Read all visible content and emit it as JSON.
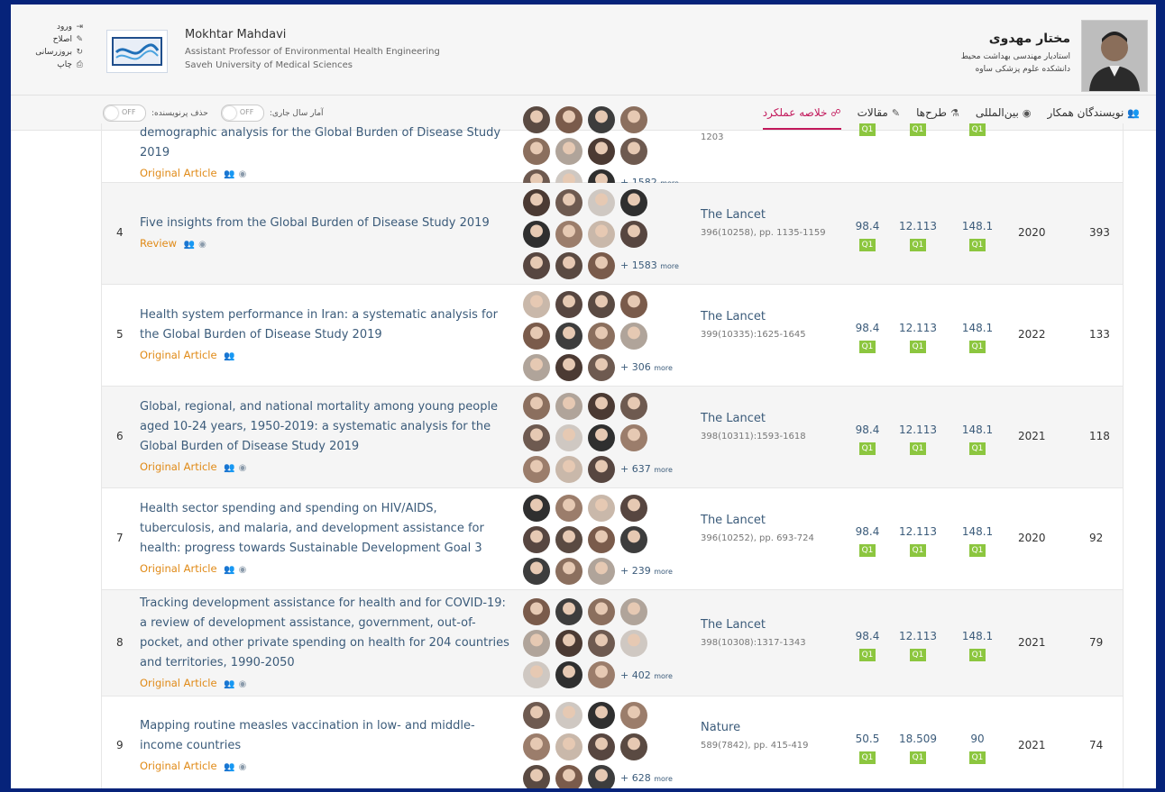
{
  "header": {
    "actions": [
      {
        "label": "ورود",
        "icon": "sign-in-icon",
        "glyph": "⇥"
      },
      {
        "label": "اصلاح",
        "icon": "pencil-icon",
        "glyph": "✎"
      },
      {
        "label": "بروزرسانی",
        "icon": "refresh-icon",
        "glyph": "↻"
      },
      {
        "label": "چاپ",
        "icon": "print-icon",
        "glyph": "⎙"
      }
    ],
    "en_name": "Mokhtar Mahdavi",
    "en_title": "Assistant Professor of Environmental Health Engineering",
    "en_affiliation": "Saveh University of Medical Sciences",
    "fa_name": "مختار مهدوی",
    "fa_title": "استادیار مهندسی بهداشت محیط",
    "fa_affiliation": "دانشکده علوم پزشکی ساوه"
  },
  "nav": {
    "tabs": [
      {
        "label": "خلاصه عملکرد",
        "icon": "summary-icon",
        "glyph": "☍",
        "active": true
      },
      {
        "label": "مقالات",
        "icon": "pencil-icon",
        "glyph": "✎",
        "active": false
      },
      {
        "label": "طرح‌ها",
        "icon": "flask-icon",
        "glyph": "⚗",
        "active": false
      },
      {
        "label": "بین‌المللی",
        "icon": "globe-icon",
        "glyph": "◉",
        "active": false
      },
      {
        "label": "نویسندگان همکار",
        "icon": "users-icon",
        "glyph": "👥",
        "active": false
      }
    ],
    "toggle_current_year": "آمار سال جاری:",
    "toggle_remove_prolific": "حذف پرنویسنده:",
    "toggle_state": "OFF"
  },
  "rows": [
    {
      "num": "",
      "title": "demographic analysis for the Global Burden of Disease Study 2019",
      "type": "Original Article",
      "intl": true,
      "more": "+ 1582",
      "journal": "",
      "ref": "1203",
      "m1": "",
      "m2": "",
      "m3": "",
      "q": "Q1",
      "year": "",
      "cites": ""
    },
    {
      "num": "4",
      "title": "Five insights from the Global Burden of Disease Study 2019",
      "type": "Review",
      "intl": true,
      "more": "+ 1583",
      "journal": "The Lancet",
      "ref": "396(10258), pp. 1135-1159",
      "m1": "98.4",
      "m2": "12.113",
      "m3": "148.1",
      "q": "Q1",
      "year": "2020",
      "cites": "393"
    },
    {
      "num": "5",
      "title": "Health system performance in Iran: a systematic analysis for the Global Burden of Disease Study 2019",
      "type": "Original Article",
      "intl": false,
      "more": "+ 306",
      "journal": "The Lancet",
      "ref": "399(10335):1625-1645",
      "m1": "98.4",
      "m2": "12.113",
      "m3": "148.1",
      "q": "Q1",
      "year": "2022",
      "cites": "133"
    },
    {
      "num": "6",
      "title": "Global, regional, and national mortality among young people aged 10-24 years, 1950-2019: a systematic analysis for the Global Burden of Disease Study 2019",
      "type": "Original Article",
      "intl": true,
      "more": "+ 637",
      "journal": "The Lancet",
      "ref": "398(10311):1593-1618",
      "m1": "98.4",
      "m2": "12.113",
      "m3": "148.1",
      "q": "Q1",
      "year": "2021",
      "cites": "118"
    },
    {
      "num": "7",
      "title": "Health sector spending and spending on HIV/AIDS, tuberculosis, and malaria, and development assistance for health: progress towards Sustainable Development Goal 3",
      "type": "Original Article",
      "intl": true,
      "more": "+ 239",
      "journal": "The Lancet",
      "ref": "396(10252), pp. 693-724",
      "m1": "98.4",
      "m2": "12.113",
      "m3": "148.1",
      "q": "Q1",
      "year": "2020",
      "cites": "92"
    },
    {
      "num": "8",
      "title": "Tracking development assistance for health and for COVID-19: a review of development assistance, government, out-of-pocket, and other private spending on health for 204 countries and territories, 1990-2050",
      "type": "Original Article",
      "intl": true,
      "more": "+ 402",
      "journal": "The Lancet",
      "ref": "398(10308):1317-1343",
      "m1": "98.4",
      "m2": "12.113",
      "m3": "148.1",
      "q": "Q1",
      "year": "2021",
      "cites": "79"
    },
    {
      "num": "9",
      "title": "Mapping routine measles vaccination in low- and middle-income countries",
      "type": "Original Article",
      "intl": true,
      "more": "+ 628",
      "journal": "Nature",
      "ref": "589(7842), pp. 415-419",
      "m1": "50.5",
      "m2": "18.509",
      "m3": "90",
      "q": "Q1",
      "year": "2021",
      "cites": "74"
    }
  ],
  "more_suffix": "more"
}
